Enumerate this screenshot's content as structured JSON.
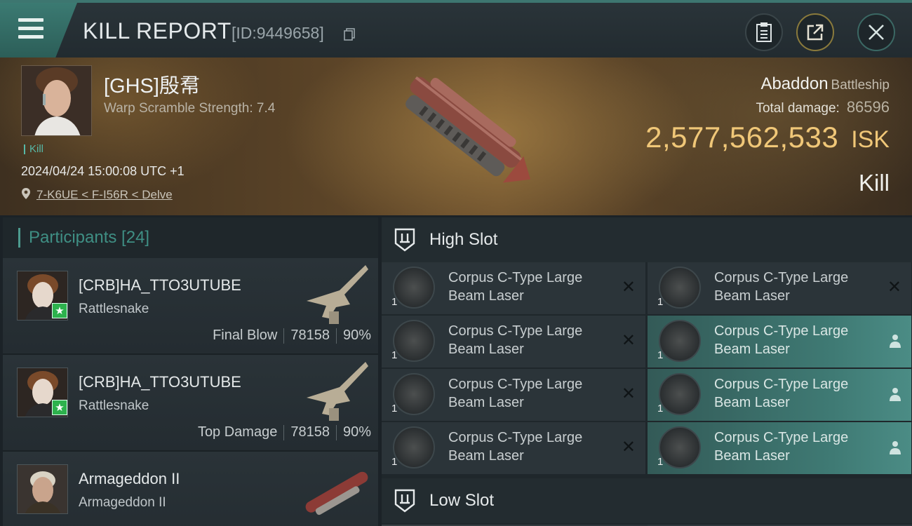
{
  "header": {
    "title": "KILL REPORT",
    "report_id": "[ID:9449658]"
  },
  "victim": {
    "pilot_name": "[GHS]殷帬",
    "warp_scramble": "Warp Scramble Strength: 7.4",
    "kill_tag": "Kill",
    "datetime": "2024/04/24 15:00:08 UTC +1",
    "location": "7-K6UE < F-I56R < Delve",
    "ship_name": "Abaddon",
    "ship_class": "Battleship",
    "total_damage_label": "Total damage:",
    "total_damage": "86596",
    "isk_value": "2,577,562,533",
    "isk_unit": "ISK",
    "result": "Kill"
  },
  "participants": {
    "label": "Participants [24]",
    "items": [
      {
        "name": "[CRB]HA_TTO3UTUBE",
        "ship": "Rattlesnake",
        "role": "Final Blow",
        "damage": "78158",
        "percent": "90%"
      },
      {
        "name": "[CRB]HA_TTO3UTUBE",
        "ship": "Rattlesnake",
        "role": "Top Damage",
        "damage": "78158",
        "percent": "90%"
      },
      {
        "name": "Armageddon II",
        "ship": "Armageddon II",
        "role": "",
        "damage": "",
        "percent": ""
      }
    ]
  },
  "fitting": {
    "high_slot_label": "High Slot",
    "low_slot_label": "Low Slot",
    "modules": [
      {
        "name": "Corpus C-Type Large Beam Laser",
        "qty": "1",
        "state": "destroyed"
      },
      {
        "name": "Corpus C-Type Large Beam Laser",
        "qty": "1",
        "state": "destroyed"
      },
      {
        "name": "Corpus C-Type Large Beam Laser",
        "qty": "1",
        "state": "destroyed"
      },
      {
        "name": "Corpus C-Type Large Beam Laser",
        "qty": "1",
        "state": "dropped"
      },
      {
        "name": "Corpus C-Type Large Beam Laser",
        "qty": "1",
        "state": "destroyed"
      },
      {
        "name": "Corpus C-Type Large Beam Laser",
        "qty": "1",
        "state": "dropped"
      },
      {
        "name": "Corpus C-Type Large Beam Laser",
        "qty": "1",
        "state": "destroyed"
      },
      {
        "name": "Corpus C-Type Large Beam Laser",
        "qty": "1",
        "state": "dropped"
      }
    ]
  },
  "colors": {
    "accent_teal": "#4d9b8f",
    "isk_gold": "#f0c778",
    "active_module": "#3f7a74"
  },
  "icons": [
    "menu-icon",
    "copy-icon",
    "clipboard-icon",
    "share-icon",
    "close-icon",
    "location-pin-icon",
    "high-slot-icon",
    "low-slot-icon",
    "destroyed-x-icon",
    "person-icon",
    "star-icon"
  ]
}
